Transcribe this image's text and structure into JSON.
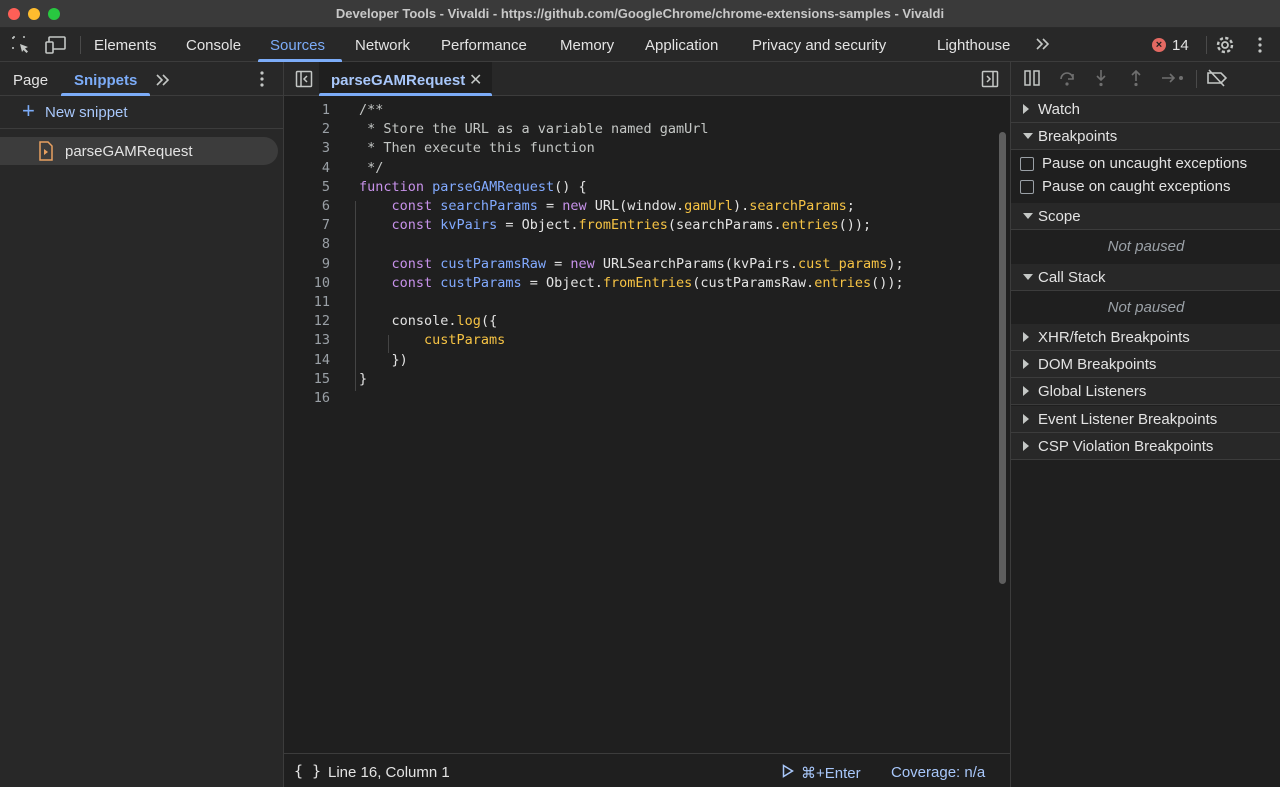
{
  "window": {
    "title": "Developer Tools - Vivaldi - https://github.com/GoogleChrome/chrome-extensions-samples - Vivaldi"
  },
  "main_tabs": [
    "Elements",
    "Console",
    "Sources",
    "Network",
    "Performance",
    "Memory",
    "Application",
    "Privacy and security",
    "Lighthouse"
  ],
  "active_tab": "Sources",
  "error_count": "14",
  "left_pane": {
    "tabs": [
      "Page",
      "Snippets"
    ],
    "new_snippet_label": "New snippet",
    "snippets": [
      "parseGAMRequest"
    ]
  },
  "editor": {
    "tab_label": "parseGAMRequest",
    "line_numbers": [
      "1",
      "2",
      "3",
      "4",
      "5",
      "6",
      "7",
      "8",
      "9",
      "10",
      "11",
      "12",
      "13",
      "14",
      "15",
      "16"
    ]
  },
  "status": {
    "cursor": "Line 16, Column 1",
    "run_shortcut": "⌘+Enter",
    "coverage": "Coverage: n/a"
  },
  "debugger": {
    "watch": "Watch",
    "breakpoints": "Breakpoints",
    "pause_uncaught": "Pause on uncaught exceptions",
    "pause_caught": "Pause on caught exceptions",
    "scope": "Scope",
    "scope_state": "Not paused",
    "call_stack": "Call Stack",
    "call_stack_state": "Not paused",
    "xhr": "XHR/fetch Breakpoints",
    "dom": "DOM Breakpoints",
    "global": "Global Listeners",
    "event": "Event Listener Breakpoints",
    "csp": "CSP Violation Breakpoints"
  },
  "colors": {
    "accent": "#7cacf8",
    "keyword": "#c792ea",
    "property": "#f6c344",
    "error": "#e46962"
  }
}
